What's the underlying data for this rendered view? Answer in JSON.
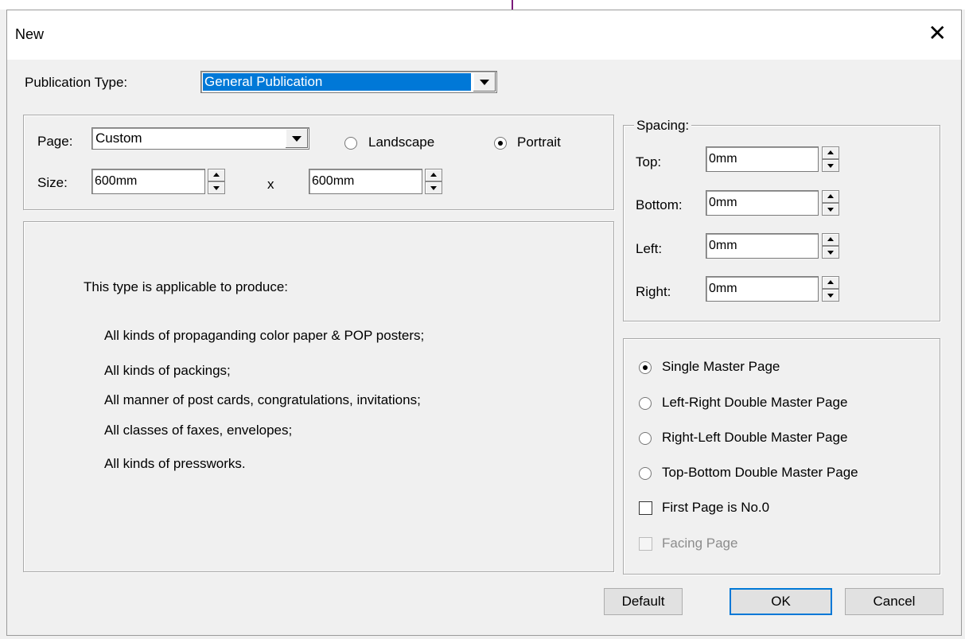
{
  "window": {
    "title": "New",
    "close_glyph": "✕"
  },
  "publication_type": {
    "label": "Publication Type:",
    "value": "General Publication"
  },
  "page": {
    "label": "Page:",
    "value": "Custom",
    "landscape_label": "Landscape",
    "portrait_label": "Portrait",
    "orientation": "Portrait",
    "size_label": "Size:",
    "width": "600mm",
    "height": "600mm",
    "separator": "x"
  },
  "description": {
    "heading": "This type is applicable to produce:",
    "items": [
      "All kinds of propaganding color paper & POP posters;",
      "All kinds of packings;",
      "All manner of post cards, congratulations, invitations;",
      "All classes of faxes, envelopes;",
      "All kinds of pressworks."
    ]
  },
  "spacing": {
    "legend": "Spacing:",
    "top_label": "Top:",
    "top": "0mm",
    "bottom_label": "Bottom:",
    "bottom": "0mm",
    "left_label": "Left:",
    "left": "0mm",
    "right_label": "Right:",
    "right": "0mm"
  },
  "master": {
    "options": [
      "Single Master Page",
      "Left-Right Double Master Page",
      "Right-Left Double Master Page",
      "Top-Bottom Double Master Page"
    ],
    "selected_index": 0,
    "first_page_label": "First Page is No.0",
    "first_page_checked": false,
    "facing_label": "Facing Page",
    "facing_enabled": false
  },
  "buttons": {
    "default": "Default",
    "ok": "OK",
    "cancel": "Cancel"
  },
  "colors": {
    "selection": "#0078d7",
    "window_bg": "#f0f0f0",
    "title_bg": "#ffffff"
  }
}
